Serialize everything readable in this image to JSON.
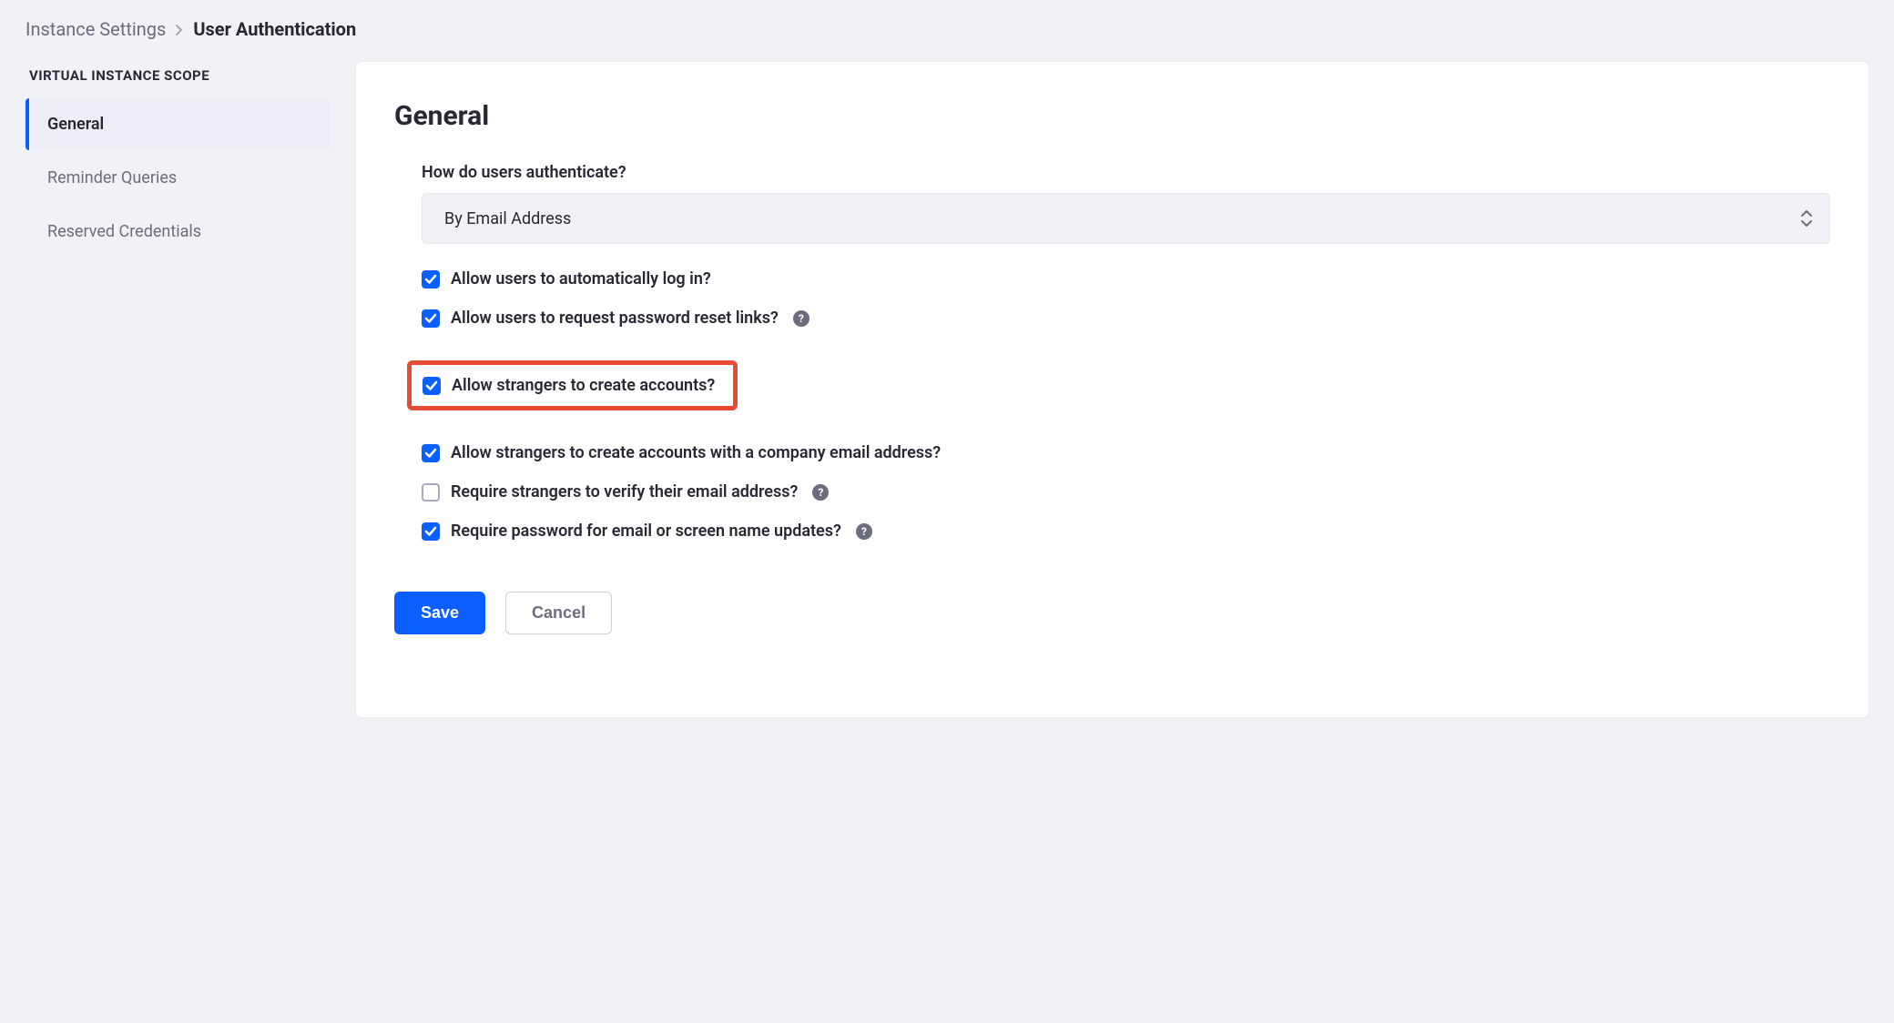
{
  "breadcrumb": {
    "parent": "Instance Settings",
    "current": "User Authentication"
  },
  "sidebar": {
    "heading": "Virtual Instance Scope",
    "items": [
      {
        "label": "General",
        "active": true
      },
      {
        "label": "Reminder Queries",
        "active": false
      },
      {
        "label": "Reserved Credentials",
        "active": false
      }
    ]
  },
  "panel": {
    "title": "General",
    "auth_method": {
      "label": "How do users authenticate?",
      "value": "By Email Address"
    },
    "checkboxes": [
      {
        "label": "Allow users to automatically log in?",
        "checked": true,
        "help": false,
        "highlighted": false
      },
      {
        "label": "Allow users to request password reset links?",
        "checked": true,
        "help": true,
        "highlighted": false
      },
      {
        "label": "Allow strangers to create accounts?",
        "checked": true,
        "help": false,
        "highlighted": true
      },
      {
        "label": "Allow strangers to create accounts with a company email address?",
        "checked": true,
        "help": false,
        "highlighted": false
      },
      {
        "label": "Require strangers to verify their email address?",
        "checked": false,
        "help": true,
        "highlighted": false
      },
      {
        "label": "Require password for email or screen name updates?",
        "checked": true,
        "help": true,
        "highlighted": false
      }
    ],
    "actions": {
      "save": "Save",
      "cancel": "Cancel"
    }
  }
}
